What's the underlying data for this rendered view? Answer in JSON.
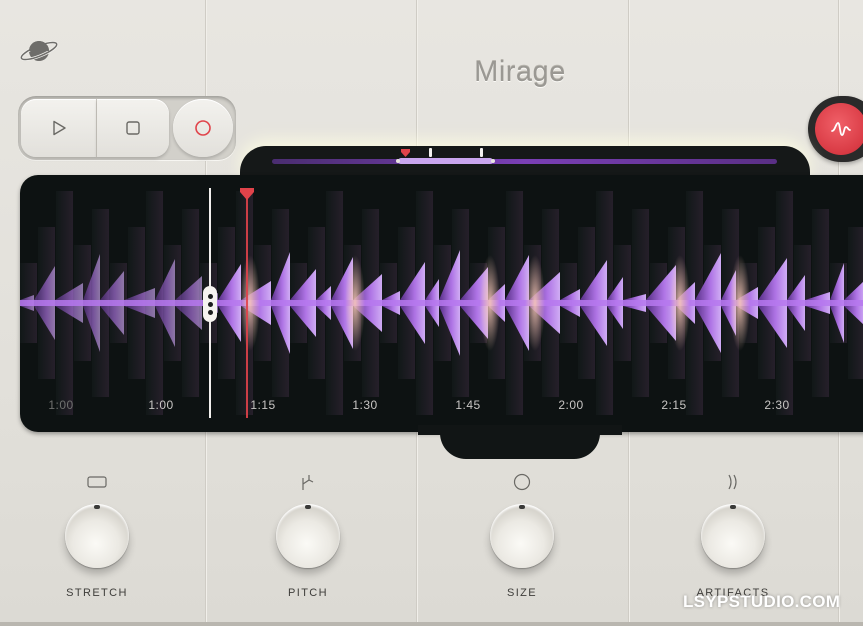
{
  "app": {
    "title": "Mirage"
  },
  "transport": {
    "play_icon": "play-icon",
    "stop_icon": "stop-icon",
    "record_icon": "record-icon",
    "accent_record": "#e0434a"
  },
  "mode_button": {
    "icon": "waveform-squiggle-icon",
    "color": "#d93a44"
  },
  "timeline": {
    "labels": [
      "1:00",
      "1:00",
      "1:15",
      "1:30",
      "1:45",
      "2:00",
      "2:15",
      "2:30"
    ],
    "wave_colors": {
      "primary": "#b678ef",
      "highlight": "#f2b0a8",
      "background": "#0d1212"
    }
  },
  "controls": {
    "knobs": [
      {
        "label": "STRETCH",
        "icon": "rectangle-icon"
      },
      {
        "label": "PITCH",
        "icon": "pitch-bend-icon"
      },
      {
        "label": "SIZE",
        "icon": "circle-icon"
      },
      {
        "label": "ARTIFACTS",
        "icon": "wave-ripple-icon"
      }
    ]
  },
  "watermark": "LSYPSTUDIO.COM"
}
